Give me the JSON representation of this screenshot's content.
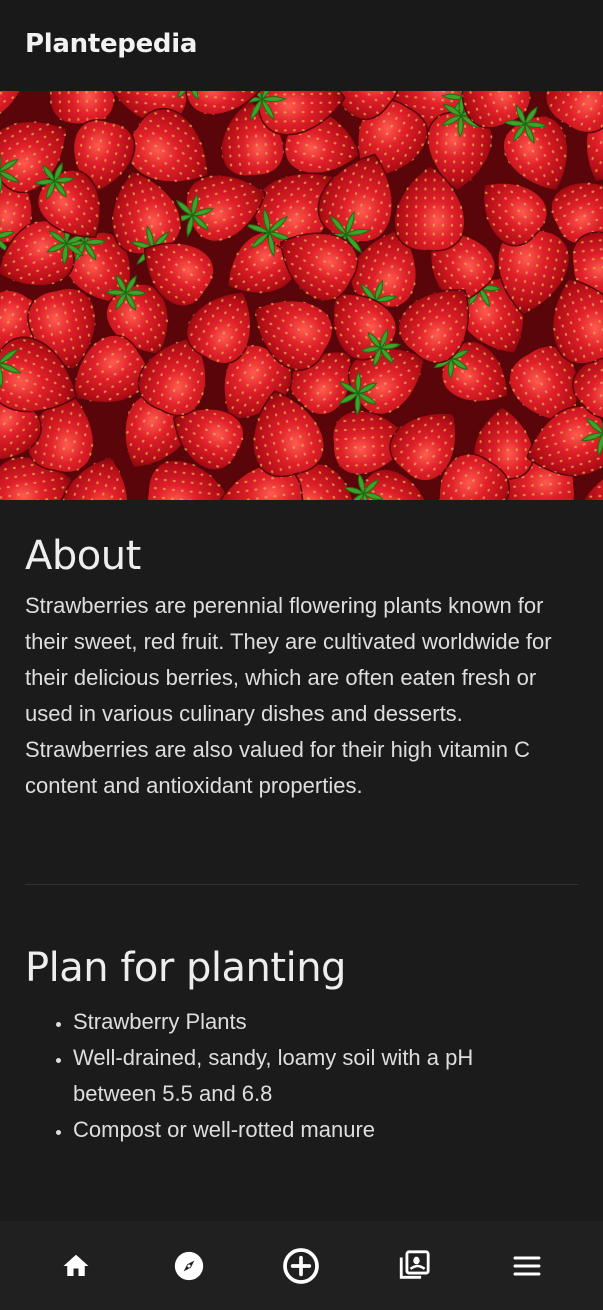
{
  "header": {
    "title": "Plantepedia"
  },
  "hero": {
    "image_label": "strawberries-photo"
  },
  "about": {
    "title": "About",
    "text": "Strawberries are perennial flowering plants known for their sweet, red fruit. They are cultivated worldwide for their delicious berries, which are often eaten fresh or used in various culinary dishes and desserts. Strawberries are also valued for their high vitamin C content and antioxidant properties."
  },
  "plan": {
    "title": "Plan for planting",
    "items": [
      "Strawberry Plants",
      "Well-drained, sandy, loamy soil with a pH between 5.5 and 6.8",
      "Compost or well-rotted manure"
    ]
  },
  "bottom_nav": {
    "items": [
      {
        "icon": "home-icon"
      },
      {
        "icon": "compass-icon"
      },
      {
        "icon": "add-circle-icon"
      },
      {
        "icon": "collection-icon"
      },
      {
        "icon": "menu-icon"
      }
    ]
  },
  "colors": {
    "background": "#1b1b1b",
    "topbar": "#191919",
    "bottom_nav": "#202020",
    "text": "#dedede",
    "strawberry_red": "#c8141e",
    "leaf_green": "#3fa32a"
  }
}
